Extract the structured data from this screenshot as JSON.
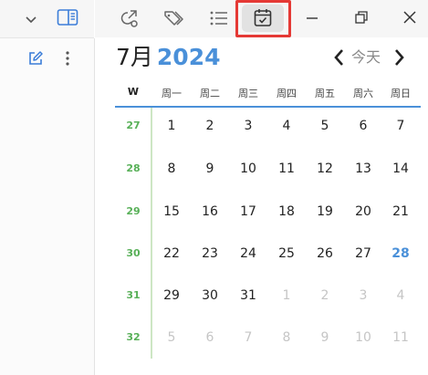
{
  "toolbar": {
    "icons": [
      "chevron-down-icon",
      "sidebar-toggle-icon",
      "share-icon",
      "tags-icon",
      "list-icon",
      "calendar-check-icon",
      "minimize-icon",
      "restore-icon",
      "close-icon"
    ]
  },
  "sidebar": {
    "icons": [
      "edit-icon",
      "more-vertical-icon"
    ]
  },
  "calendar": {
    "month_label": "7月",
    "year_label": "2024",
    "today_label": "今天",
    "week_header": "W",
    "weekday_headers": [
      "周一",
      "周二",
      "周三",
      "周四",
      "周五",
      "周六",
      "周日"
    ],
    "weeks": [
      {
        "num": "27",
        "days": [
          "1",
          "2",
          "3",
          "4",
          "5",
          "6",
          "7"
        ]
      },
      {
        "num": "28",
        "days": [
          "8",
          "9",
          "10",
          "11",
          "12",
          "13",
          "14"
        ]
      },
      {
        "num": "29",
        "days": [
          "15",
          "16",
          "17",
          "18",
          "19",
          "20",
          "21"
        ]
      },
      {
        "num": "30",
        "days": [
          "22",
          "23",
          "24",
          "25",
          "26",
          "27",
          "28"
        ]
      },
      {
        "num": "31",
        "days": [
          "29",
          "30",
          "31",
          "1",
          "2",
          "3",
          "4"
        ]
      },
      {
        "num": "32",
        "days": [
          "5",
          "6",
          "7",
          "8",
          "9",
          "10",
          "11"
        ]
      }
    ],
    "today_date": "28"
  },
  "colors": {
    "accent": "#4a90d9",
    "week_number": "#58b058",
    "highlight": "#e53935"
  }
}
